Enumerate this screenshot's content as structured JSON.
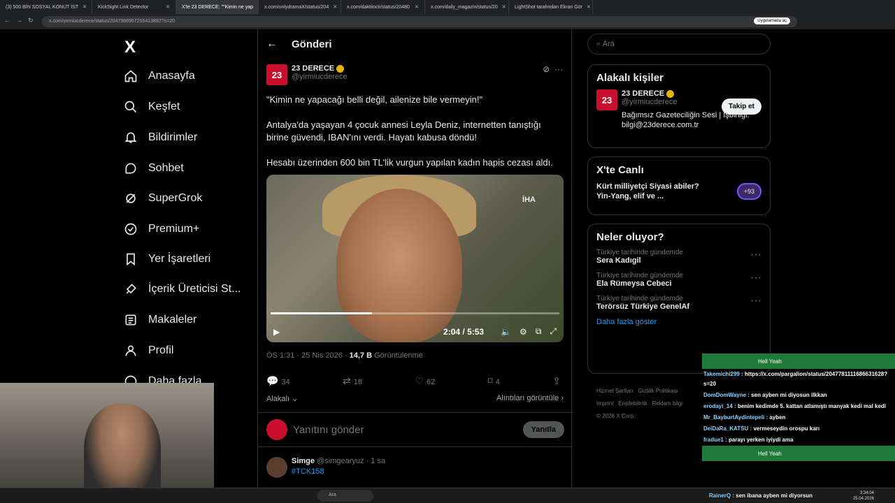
{
  "browser": {
    "tabs": [
      {
        "label": "(3) 500 BİN SOSYAL KONUT İST"
      },
      {
        "label": "KickSight Link Detector"
      },
      {
        "label": "X'te 23 DERECE: \"\"Kimin ne yap",
        "active": true
      },
      {
        "label": "x.com/onlydramaX/status/204"
      },
      {
        "label": "x.com/daktilock/status/20480"
      },
      {
        "label": "x.com/daily_magazin/status/20"
      },
      {
        "label": "LightShot tarafından Ekran Gör"
      }
    ],
    "url": "x.com/yirmiucderece/status/2047986957255413892?s=20",
    "app_pill": "Uygulamada aç"
  },
  "sidebar": {
    "logo": "X",
    "items": [
      {
        "label": "Anasayfa",
        "icon": "home-icon"
      },
      {
        "label": "Keşfet",
        "icon": "search-icon"
      },
      {
        "label": "Bildirimler",
        "icon": "bell-icon"
      },
      {
        "label": "Sohbet",
        "icon": "chat-icon"
      },
      {
        "label": "SuperGrok",
        "icon": "grok-icon"
      },
      {
        "label": "Premium+",
        "icon": "verified-icon"
      },
      {
        "label": "Yer İşaretleri",
        "icon": "bookmark-icon"
      },
      {
        "label": "İçerik Üreticisi St...",
        "icon": "rocket-icon"
      },
      {
        "label": "Makaleler",
        "icon": "article-icon"
      },
      {
        "label": "Profil",
        "icon": "person-icon"
      },
      {
        "label": "Daha fazla",
        "icon": "more-icon"
      }
    ]
  },
  "post": {
    "header": "Gönderi",
    "author_name": "23 DERECE",
    "author_handle": "@yirmiucderece",
    "avatar_text": "23",
    "text": [
      "\"Kimin ne yapacağı belli değil, ailenize bile vermeyin!\"",
      "Antalya'da yaşayan 4 çocuk annesi Leyla Deniz, internetten tanıştığı birine güvendi, IBAN'ını verdi. Hayatı kabusa döndü!",
      "Hesabı üzerinden 600 bin TL'lik vurgun yapılan kadın hapis cezası aldı."
    ],
    "video": {
      "watermark": "İHA",
      "time": "2:04 / 5:53",
      "progress": 0.35
    },
    "timestamp": "ÖS 1:31 · 25 Nis 2026 ·",
    "views": "14,7 B",
    "views_label": "Görüntülenme",
    "stats": {
      "replies": "34",
      "reposts": "18",
      "likes": "62",
      "bookmarks": "4"
    },
    "related_label": "Alakalı",
    "alt_views": "Alıntıları görüntüle",
    "reply_placeholder": "Yanıtını gönder",
    "reply_button": "Yanıtla"
  },
  "next_post": {
    "name": "Simge",
    "handle": "@simgearyuz",
    "time": "· 1 sa",
    "hashtag": "#TCK158"
  },
  "right": {
    "search_placeholder": "Ara",
    "related_title": "Alakalı kişiler",
    "related_name": "23 DERECE",
    "related_handle": "@yirmiucderece",
    "follow_label": "Takip et",
    "related_bio": "Bağımsız Gazeteciliğin Sesi | İşbirliği: bilgi@23derece.com.tr",
    "live_title": "X'te Canlı",
    "live_text": "Kürt milliyetçi Siyasi abiler?Yin-Yang, elif ve ...",
    "live_count": "+93",
    "trends_title": "Neler oluyor?",
    "trends": [
      {
        "context": "Türkiye tarihinde gündemde",
        "title": "Sera Kadıgil"
      },
      {
        "context": "Türkiye tarihinde gündemde",
        "title": "Ela Rümeysa Cebeci"
      },
      {
        "context": "Türkiye tarihinde gündemde",
        "title": "Terörsüz Türkiye GenelAf"
      }
    ],
    "show_more": "Daha fazla göster",
    "footer": [
      "Hizmet Şartları",
      "Gizlilik Politikası",
      "Imprint",
      "Erişilebilirlik",
      "Reklam bilgi",
      "© 2026 X Corp."
    ]
  },
  "chat": {
    "bar1": "Hell Yeah",
    "lines": [
      {
        "user": "Takemichi299 :",
        "msg": "https://x.com/pargalion/status/2047781111686631628?s=20"
      },
      {
        "user": "DomDomWayne :",
        "msg": "sen ayben mi diyosun ilkkan"
      },
      {
        "user": "erodayi_14 :",
        "msg": "benim kedimde 5. kattan atlamıştı manyak kedi mal kedi"
      },
      {
        "user": "Mr_BayburtAydintepeli :",
        "msg": "ayben"
      },
      {
        "user": "DeiDaRa_KATSU :",
        "msg": "vermeseydin orospu karı"
      },
      {
        "user": "fradue1 :",
        "msg": "parayı yerken iyiydi ama"
      }
    ],
    "bar2": "Hell Yeah",
    "last": {
      "user": "RainerQ :",
      "msg": "sen ibana ayben mi diyorsun"
    }
  },
  "taskbar": {
    "search": "Ara",
    "time": "3:34:04",
    "date": "25.04.2026"
  },
  "colors": {
    "accent": "#1d9bf0",
    "brand_red": "#c8102e",
    "verified_gold": "#e8b400"
  }
}
